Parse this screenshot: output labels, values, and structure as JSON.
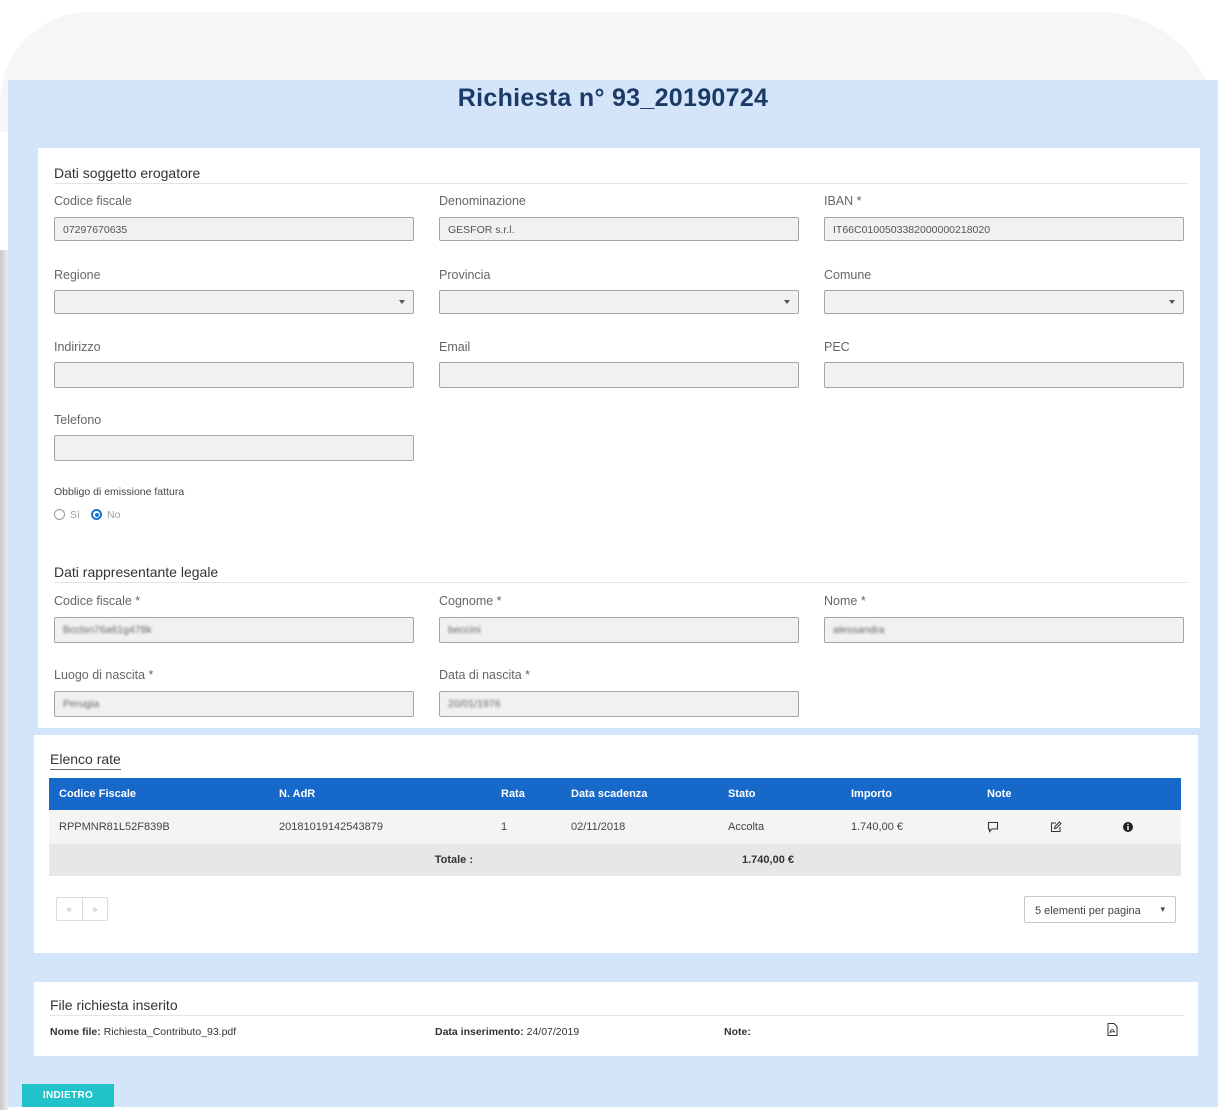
{
  "page": {
    "title": "Richiesta n° 93_20190724"
  },
  "erogatore": {
    "heading": "Dati soggetto erogatore",
    "codice_fiscale": {
      "label": "Codice fiscale",
      "value": "07297670635"
    },
    "denominazione": {
      "label": "Denominazione",
      "value": "GESFOR s.r.l."
    },
    "iban": {
      "label": "IBAN *",
      "value": "IT66C0100503382000000218020"
    },
    "regione": {
      "label": "Regione",
      "value": ""
    },
    "provincia": {
      "label": "Provincia",
      "value": ""
    },
    "comune": {
      "label": "Comune",
      "value": ""
    },
    "indirizzo": {
      "label": "Indirizzo",
      "value": ""
    },
    "email": {
      "label": "Email",
      "value": ""
    },
    "pec": {
      "label": "PEC",
      "value": ""
    },
    "telefono": {
      "label": "Telefono",
      "value": ""
    },
    "fattura": {
      "label": "Obbligo di emissione fattura",
      "opt_si": "Sì",
      "opt_no": "No",
      "selected": "No"
    }
  },
  "rappresentante": {
    "heading": "Dati rappresentante legale",
    "codice_fiscale": {
      "label": "Codice fiscale *",
      "value": "Bcclsn76a61g478k"
    },
    "cognome": {
      "label": "Cognome *",
      "value": "beccini"
    },
    "nome": {
      "label": "Nome *",
      "value": "alessandra"
    },
    "luogo_nascita": {
      "label": "Luogo di nascita *",
      "value": "Perugia"
    },
    "data_nascita": {
      "label": "Data di nascita *",
      "value": "20/01/1976"
    }
  },
  "rate": {
    "heading": "Elenco rate",
    "columns": [
      "Codice Fiscale",
      "N. AdR",
      "Rata",
      "Data scadenza",
      "Stato",
      "Importo",
      "Note"
    ],
    "rows": [
      {
        "codice_fiscale": "RPPMNR81L52F839B",
        "n_adr": "20181019142543879",
        "rata": "1",
        "data_scadenza": "02/11/2018",
        "stato": "Accolta",
        "importo": "1.740,00 €"
      }
    ],
    "total_label": "Totale :",
    "total_value": "1.740,00 €",
    "pager_prev": "«",
    "pager_next": "»",
    "page_size": "5 elementi per pagina",
    "icons": [
      "comment-icon",
      "edit-icon",
      "info-icon"
    ]
  },
  "file": {
    "heading": "File richiesta inserito",
    "nome_label": "Nome file:",
    "nome_value": "Richiesta_Contributo_93.pdf",
    "data_label": "Data inserimento:",
    "data_value": "24/07/2019",
    "note_label": "Note:"
  },
  "actions": {
    "back_label": "INDIETRO"
  },
  "colors": {
    "primary": "#1769c9",
    "accent": "#1fc3c9",
    "frame_bg": "#d4e5f9",
    "title": "#1c3a66"
  }
}
